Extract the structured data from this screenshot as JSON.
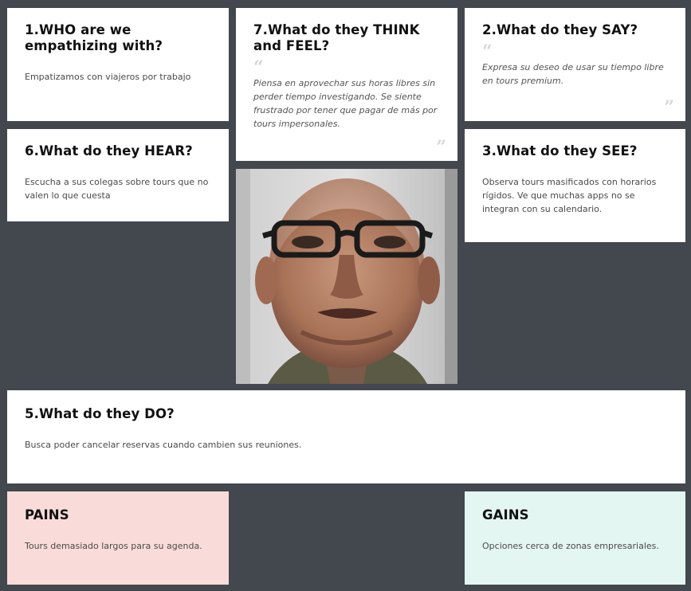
{
  "cards": {
    "who": {
      "title": "1.WHO are we empathizing with?",
      "text": "Empatizamos con viajeros por trabajo"
    },
    "think": {
      "title": "7.What do they THINK and FEEL?",
      "text": "Piensa en aprovechar sus horas libres sin perder tiempo investigando. Se siente frustrado por tener que pagar de más por tours impersonales."
    },
    "say": {
      "title": "2.What do they SAY?",
      "text": "Expresa su deseo de usar su tiempo libre en tours premium."
    },
    "hear": {
      "title": "6.What do they HEAR?",
      "text": "Escucha a sus colegas sobre  tours que no valen lo que cuesta"
    },
    "see": {
      "title": "3.What do they SEE?",
      "text": "Observa tours masificados  con horarios rígidos. Ve que muchas apps no  se integran con su calendario."
    },
    "do": {
      "title": "5.What do they DO?",
      "text": "Busca poder cancelar reservas cuando cambien sus reuniones."
    },
    "pains": {
      "title": "PAINS",
      "text": "Tours demasiado largos para su agenda."
    },
    "gains": {
      "title": "GAINS",
      "text": "Opciones cerca de zonas empresariales."
    }
  },
  "quote_marks": {
    "open": "“",
    "close": "”"
  },
  "colors": {
    "background": "#43474e",
    "card": "#ffffff",
    "pains": "#f9dcd9",
    "gains": "#e3f6f1"
  },
  "photo": {
    "subject": "persona-photo"
  }
}
